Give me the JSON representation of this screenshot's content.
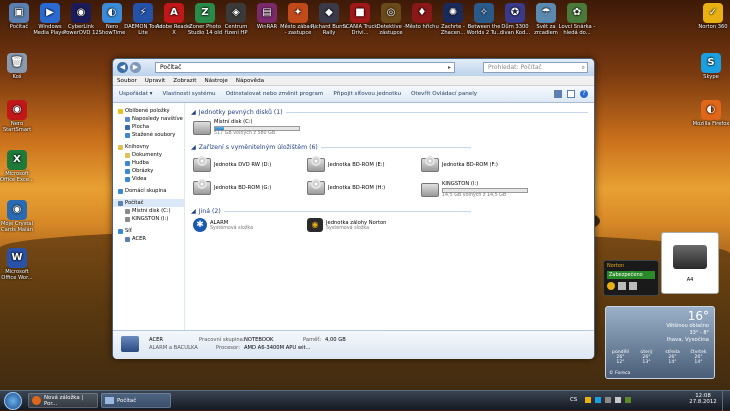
{
  "desktop_top": [
    {
      "name": "desktop-icon-pocitac",
      "label": "Počítač",
      "color": "#5a7fb0",
      "glyph": "▣"
    },
    {
      "name": "desktop-icon-wmp",
      "label": "Windows Media Player",
      "color": "#2a6ad0",
      "glyph": "▶"
    },
    {
      "name": "desktop-icon-powerdvd",
      "label": "CyberLink PowerDVD 12",
      "color": "#1b1b5a",
      "glyph": "◉"
    },
    {
      "name": "desktop-icon-nero",
      "label": "Nero ShowTime",
      "color": "#3a8ad8",
      "glyph": "◐"
    },
    {
      "name": "desktop-icon-daemon",
      "label": "DAEMON Tools Lite",
      "color": "#2452a8",
      "glyph": "⚡"
    },
    {
      "name": "desktop-icon-adobe",
      "label": "Adobe Reader X",
      "color": "#c01818",
      "glyph": "A"
    },
    {
      "name": "desktop-icon-zoner",
      "label": "Zoner Photo Studio 14 old",
      "color": "#2a8a4a",
      "glyph": "Z"
    },
    {
      "name": "desktop-icon-centrum",
      "label": "Centrum řízení HP",
      "color": "#3a3a3a",
      "glyph": "◈"
    },
    {
      "name": "desktop-icon-winrar",
      "label": "WinRAR",
      "color": "#7a2a6a",
      "glyph": "▤"
    },
    {
      "name": "desktop-icon-mesto-zaplavy",
      "label": "Město zábavy - zastupce",
      "color": "#c04a1a",
      "glyph": "✦"
    },
    {
      "name": "desktop-icon-richard-burns",
      "label": "Richard Burns Rally",
      "color": "#3a3a4a",
      "glyph": "◆"
    },
    {
      "name": "desktop-icon-scania",
      "label": "SCANIA Truck Drivi...",
      "color": "#a01818",
      "glyph": "■"
    },
    {
      "name": "desktop-icon-detective",
      "label": "Detektive - zástupce",
      "color": "#6a4a1a",
      "glyph": "◎"
    },
    {
      "name": "desktop-icon-mesto-hrichu",
      "label": "Město hříchu",
      "color": "#8a1818",
      "glyph": "♦"
    },
    {
      "name": "desktop-icon-zachrte",
      "label": "Zachrte - Zhacen...",
      "color": "#1a2a5a",
      "glyph": "✺"
    },
    {
      "name": "desktop-icon-between-worlds",
      "label": "Between the Worlds 2 Tu...",
      "color": "#2a5a8a",
      "glyph": "✧"
    },
    {
      "name": "desktop-icon-dum",
      "label": "Dům 3300 divan Kod...",
      "color": "#3a3a8a",
      "glyph": "✪"
    },
    {
      "name": "desktop-icon-svet",
      "label": "Svět za zrcadlem",
      "color": "#5a8ab0",
      "glyph": "☂"
    },
    {
      "name": "desktop-icon-lovci",
      "label": "Lovci Snárka - hledá do...",
      "color": "#4a7a3a",
      "glyph": "✿"
    },
    {
      "name": "desktop-icon-norton",
      "label": "Norton 360",
      "color": "#e8b010",
      "glyph": "✓"
    }
  ],
  "desktop_left": [
    {
      "name": "desktop-icon-kos",
      "label": "Koš",
      "color": "#8a9ab0",
      "glyph": "🗑"
    },
    {
      "name": "desktop-icon-nero-start",
      "label": "Nero StartSmart",
      "color": "#c01818",
      "glyph": "◉"
    },
    {
      "name": "desktop-icon-excel",
      "label": "Microsoft Office Exce...",
      "color": "#1f7a3a",
      "glyph": "X"
    },
    {
      "name": "desktop-icon-photo",
      "label": "Moje Crystal Cards Malán",
      "color": "#2a6ab0",
      "glyph": "◉"
    },
    {
      "name": "desktop-icon-word",
      "label": "Microsoft Office Wor...",
      "color": "#2a52a8",
      "glyph": "W"
    }
  ],
  "desktop_right": [
    {
      "name": "desktop-icon-skype",
      "label": "Skype",
      "color": "#1aa0e0",
      "glyph": "S"
    },
    {
      "name": "desktop-icon-firefox",
      "label": "Mozilla Firefox",
      "color": "#e0661a",
      "glyph": "◐"
    }
  ],
  "explorer": {
    "address": "Počítač",
    "search_placeholder": "Prohledat: Počítač",
    "menu": [
      "Soubor",
      "Upravit",
      "Zobrazit",
      "Nástroje",
      "Nápověda"
    ],
    "toolbar": [
      "Uspořádat ▾",
      "Vlastnosti systému",
      "Odinstalovat nebo změnit program",
      "Připojit síťovou jednotku",
      "Otevřít Ovládací panely"
    ],
    "nav": [
      {
        "label": "Oblíbené položky",
        "sub": false,
        "color": "#e8c020"
      },
      {
        "label": "Naposledy navštíve",
        "sub": true,
        "color": "#5a8ad0"
      },
      {
        "label": "Plocha",
        "sub": true,
        "color": "#3a6ab0"
      },
      {
        "label": "Stažené soubory",
        "sub": true,
        "color": "#3a8ad0"
      },
      {
        "gap": true
      },
      {
        "label": "Knihovny",
        "sub": false,
        "color": "#e0c050"
      },
      {
        "label": "Dokumenty",
        "sub": true,
        "color": "#e0c050"
      },
      {
        "label": "Hudba",
        "sub": true,
        "color": "#3a8ad0"
      },
      {
        "label": "Obrázky",
        "sub": true,
        "color": "#3a8ad0"
      },
      {
        "label": "Videa",
        "sub": true,
        "color": "#3a8ad0"
      },
      {
        "gap": true
      },
      {
        "label": "Domácí skupina",
        "sub": false,
        "color": "#3a8ad0"
      },
      {
        "gap": true
      },
      {
        "label": "Počítač",
        "sub": false,
        "color": "#5a7fb0",
        "selected": true
      },
      {
        "label": "Místní disk (C:)",
        "sub": true,
        "color": "#8a8a8a"
      },
      {
        "label": "KINGSTON (I:)",
        "sub": true,
        "color": "#8a8a8a"
      },
      {
        "gap": true
      },
      {
        "label": "Síť",
        "sub": false,
        "color": "#3a8ad0"
      },
      {
        "label": "ACER",
        "sub": true,
        "color": "#5a7fb0"
      }
    ],
    "groups": {
      "hdd": "Jednotky pevných disků (1)",
      "removable": "Zařízení s vyměnitelným úložištěm (6)",
      "other": "Jiná (2)"
    },
    "local_disk": {
      "name": "Místní disk (C:)",
      "free": "517 GB volných z 580 GB",
      "used_fraction": 0.11
    },
    "removable": [
      {
        "name": "Jednotka DVD RW (D:)"
      },
      {
        "name": "Jednotka BD-ROM (E:)"
      },
      {
        "name": "Jednotka BD-ROM (F:)"
      },
      {
        "name": "Jednotka BD-ROM (G:)"
      },
      {
        "name": "Jednotka BD-ROM (H:)"
      },
      {
        "name": "KINGSTON (I:)",
        "free": "14,5 GB volných z 14,5 GB",
        "used_fraction": 0.0
      }
    ],
    "other": [
      {
        "name": "ALARM",
        "sub": "Systémová složka"
      },
      {
        "name": "Jednotka zálohy Norton",
        "sub": "Systémová složka"
      }
    ],
    "details": {
      "name": "ACER",
      "subname": "ALARM a BACULKA",
      "group_label": "Pracovní skupina:",
      "group_value": "NOTEBOOK",
      "mem_label": "Paměť:",
      "mem_value": "4,00 GB",
      "cpu_label": "Procesor:",
      "cpu_value": "AMD A6-3400M APU wit..."
    }
  },
  "gadgets": {
    "norton_title": "Norton",
    "norton_status": "Zabezpečeno",
    "printer_label": "A4",
    "weather": {
      "temp": "16°",
      "desc": "Většinou oblačno",
      "hi_lo": "33° - 8°",
      "city": "Ihava, Vysočina",
      "days": [
        {
          "d": "pondělí",
          "t": "26°",
          "l": "12°"
        },
        {
          "d": "úterý",
          "t": "26°",
          "l": "13°"
        },
        {
          "d": "středa",
          "t": "26°",
          "l": "14°"
        },
        {
          "d": "čtvrtek",
          "t": "26°",
          "l": "14°"
        }
      ],
      "source": "© Foreca"
    }
  },
  "taskbar": {
    "tasks": [
      "Nová záložka | Por...",
      "Počítač"
    ],
    "lang": "CS",
    "time": "12:08",
    "date": "27.8.2012"
  }
}
